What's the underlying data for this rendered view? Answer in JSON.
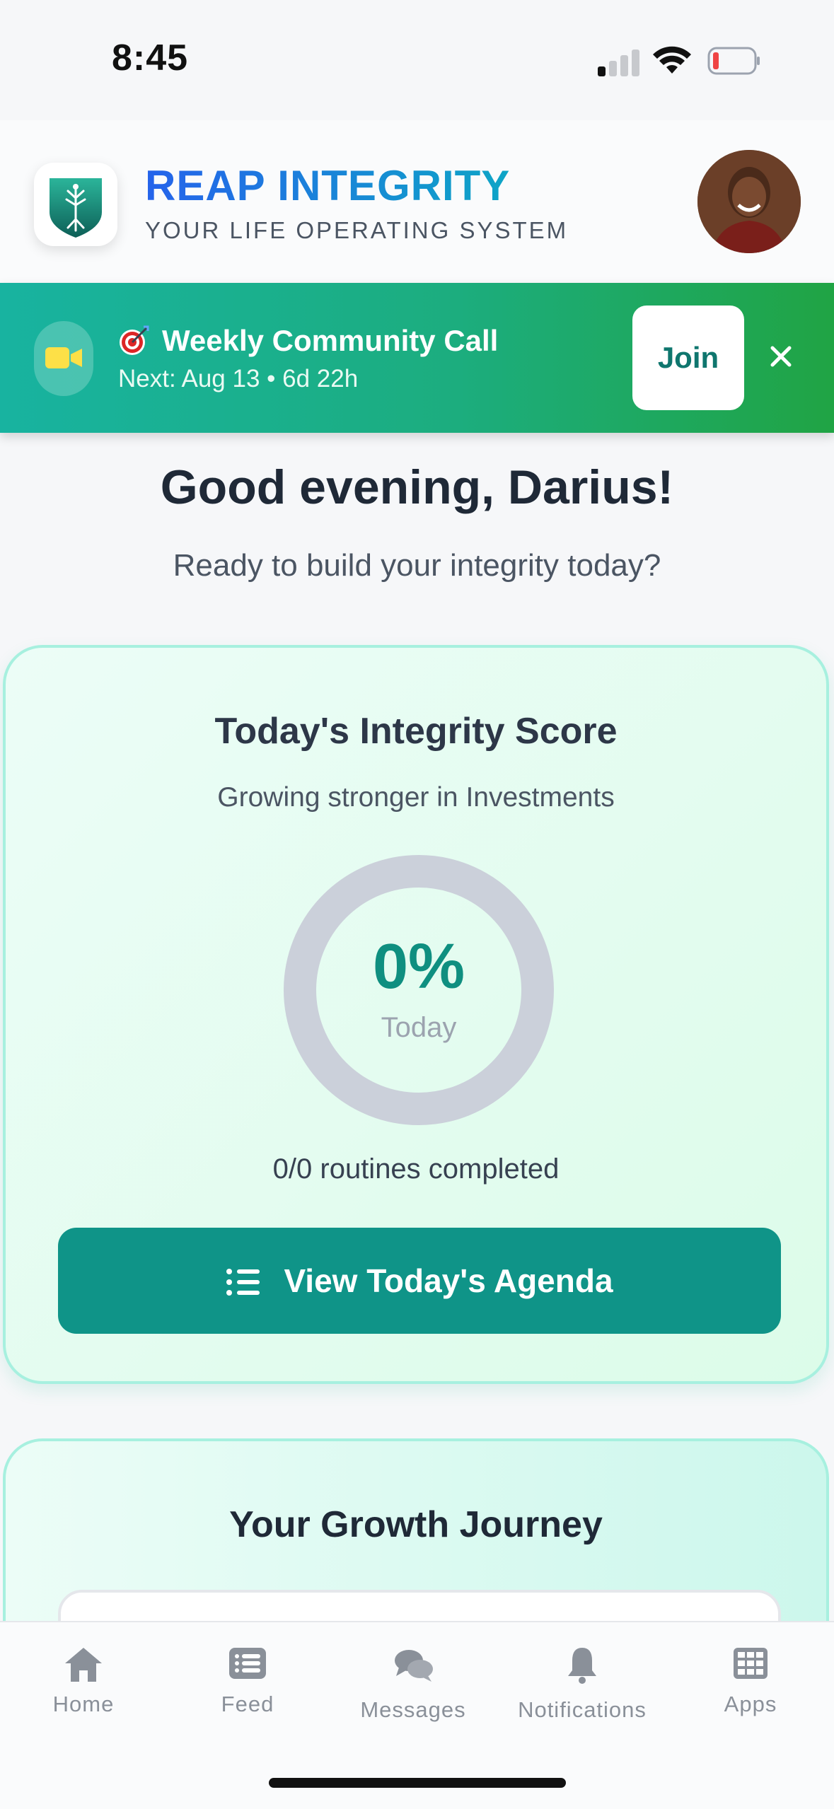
{
  "status_bar": {
    "time": "8:45"
  },
  "header": {
    "brand_title": "REAP INTEGRITY",
    "brand_subtitle": "YOUR LIFE OPERATING SYSTEM"
  },
  "banner": {
    "title": "Weekly Community Call",
    "next": "Next: Aug 13 • 6d 22h",
    "join_label": "Join"
  },
  "greeting": {
    "title": "Good evening, Darius!",
    "subtitle": "Ready to build your integrity today?"
  },
  "score_card": {
    "title": "Today's Integrity Score",
    "subtitle": "Growing stronger in Investments",
    "score_value": "0%",
    "score_fraction": 0,
    "score_label": "Today",
    "routines_text": "0/0 routines completed",
    "agenda_button": "View Today's Agenda"
  },
  "growth_card": {
    "title": "Your Growth Journey"
  },
  "tab_bar": {
    "tabs": [
      {
        "label": "Home",
        "icon": "home-icon"
      },
      {
        "label": "Feed",
        "icon": "feed-icon"
      },
      {
        "label": "Messages",
        "icon": "messages-icon"
      },
      {
        "label": "Notifications",
        "icon": "bell-icon"
      },
      {
        "label": "Apps",
        "icon": "apps-grid-icon"
      }
    ]
  },
  "colors": {
    "brand_gradient_start": "#2563eb",
    "brand_gradient_end": "#0ea5c6",
    "banner_start": "#18b3a0",
    "banner_end": "#20a444",
    "accent_teal": "#0f9488",
    "ring_track": "#cbd0da"
  }
}
